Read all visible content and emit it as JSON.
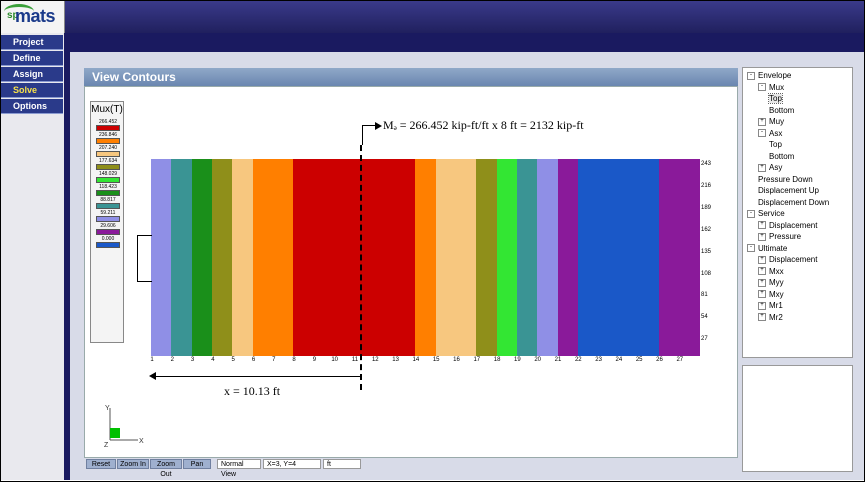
{
  "app": {
    "logo_prefix": "sp",
    "logo_main": "mats"
  },
  "nav": {
    "items": [
      {
        "label": "Project",
        "active": false
      },
      {
        "label": "Define",
        "active": false
      },
      {
        "label": "Assign",
        "active": false
      },
      {
        "label": "Solve",
        "active": true
      },
      {
        "label": "Options",
        "active": false
      }
    ]
  },
  "panel": {
    "title": "View Contours"
  },
  "legend": {
    "title": "Mux(T)",
    "levels": [
      {
        "value": "266.452",
        "color": "#cc0000"
      },
      {
        "value": "236.846",
        "color": "#ff7f00"
      },
      {
        "value": "207.240",
        "color": "#f7c77f"
      },
      {
        "value": "177.634",
        "color": "#8f8f1a"
      },
      {
        "value": "148.029",
        "color": "#33e633"
      },
      {
        "value": "118.423",
        "color": "#1a8f1a"
      },
      {
        "value": "88.817",
        "color": "#3a9494"
      },
      {
        "value": "59.211",
        "color": "#8f8fe6"
      },
      {
        "value": "29.606",
        "color": "#8a1a9a"
      },
      {
        "value": "0.000",
        "color": "#1a58c8"
      }
    ]
  },
  "annotations": {
    "moment_text": "Mₔ = 266.452 kip-ft/ft x 8 ft = 2132 kip-ft",
    "x_text": "x = 10.13 ft"
  },
  "grid": {
    "columns": [
      "1",
      "2",
      "3",
      "4",
      "5",
      "6",
      "7",
      "8",
      "9",
      "10",
      "11",
      "12",
      "13",
      "14",
      "15",
      "16",
      "17",
      "18",
      "19",
      "20",
      "21",
      "22",
      "23",
      "24",
      "25",
      "26",
      "27"
    ],
    "row_end_labels": [
      "243",
      "216",
      "189",
      "162",
      "135",
      "108",
      "81",
      "54",
      "27"
    ]
  },
  "toolbar": {
    "reset": "Reset",
    "zoom_in": "Zoom In",
    "zoom_out": "Zoom Out",
    "pan": "Pan",
    "view": "Normal View",
    "coords": "X=3, Y=4",
    "units": "ft"
  },
  "tree": {
    "nodes": [
      {
        "label": "Envelope",
        "level": 0,
        "toggle": "-"
      },
      {
        "label": "Mux",
        "level": 1,
        "toggle": "-"
      },
      {
        "label": "Top",
        "level": 2,
        "toggle": "",
        "selected": true
      },
      {
        "label": "Bottom",
        "level": 2,
        "toggle": ""
      },
      {
        "label": "Muy",
        "level": 1,
        "toggle": "+"
      },
      {
        "label": "Asx",
        "level": 1,
        "toggle": "-"
      },
      {
        "label": "Top",
        "level": 2,
        "toggle": ""
      },
      {
        "label": "Bottom",
        "level": 2,
        "toggle": ""
      },
      {
        "label": "Asy",
        "level": 1,
        "toggle": "+"
      },
      {
        "label": "Pressure Down",
        "level": 1,
        "toggle": ""
      },
      {
        "label": "Displacement Up",
        "level": 1,
        "toggle": ""
      },
      {
        "label": "Displacement Down",
        "level": 1,
        "toggle": ""
      },
      {
        "label": "Service",
        "level": 0,
        "toggle": "-"
      },
      {
        "label": "Displacement",
        "level": 1,
        "toggle": "+"
      },
      {
        "label": "Pressure",
        "level": 1,
        "toggle": "+"
      },
      {
        "label": "Ultimate",
        "level": 0,
        "toggle": "-"
      },
      {
        "label": "Displacement",
        "level": 1,
        "toggle": "+"
      },
      {
        "label": "Mxx",
        "level": 1,
        "toggle": "+"
      },
      {
        "label": "Myy",
        "level": 1,
        "toggle": "+"
      },
      {
        "label": "Mxy",
        "level": 1,
        "toggle": "+"
      },
      {
        "label": "Mr1",
        "level": 1,
        "toggle": "+"
      },
      {
        "label": "Mr2",
        "level": 1,
        "toggle": "+"
      }
    ]
  },
  "axes": {
    "y": "Y",
    "z": "Z",
    "x": "X"
  }
}
